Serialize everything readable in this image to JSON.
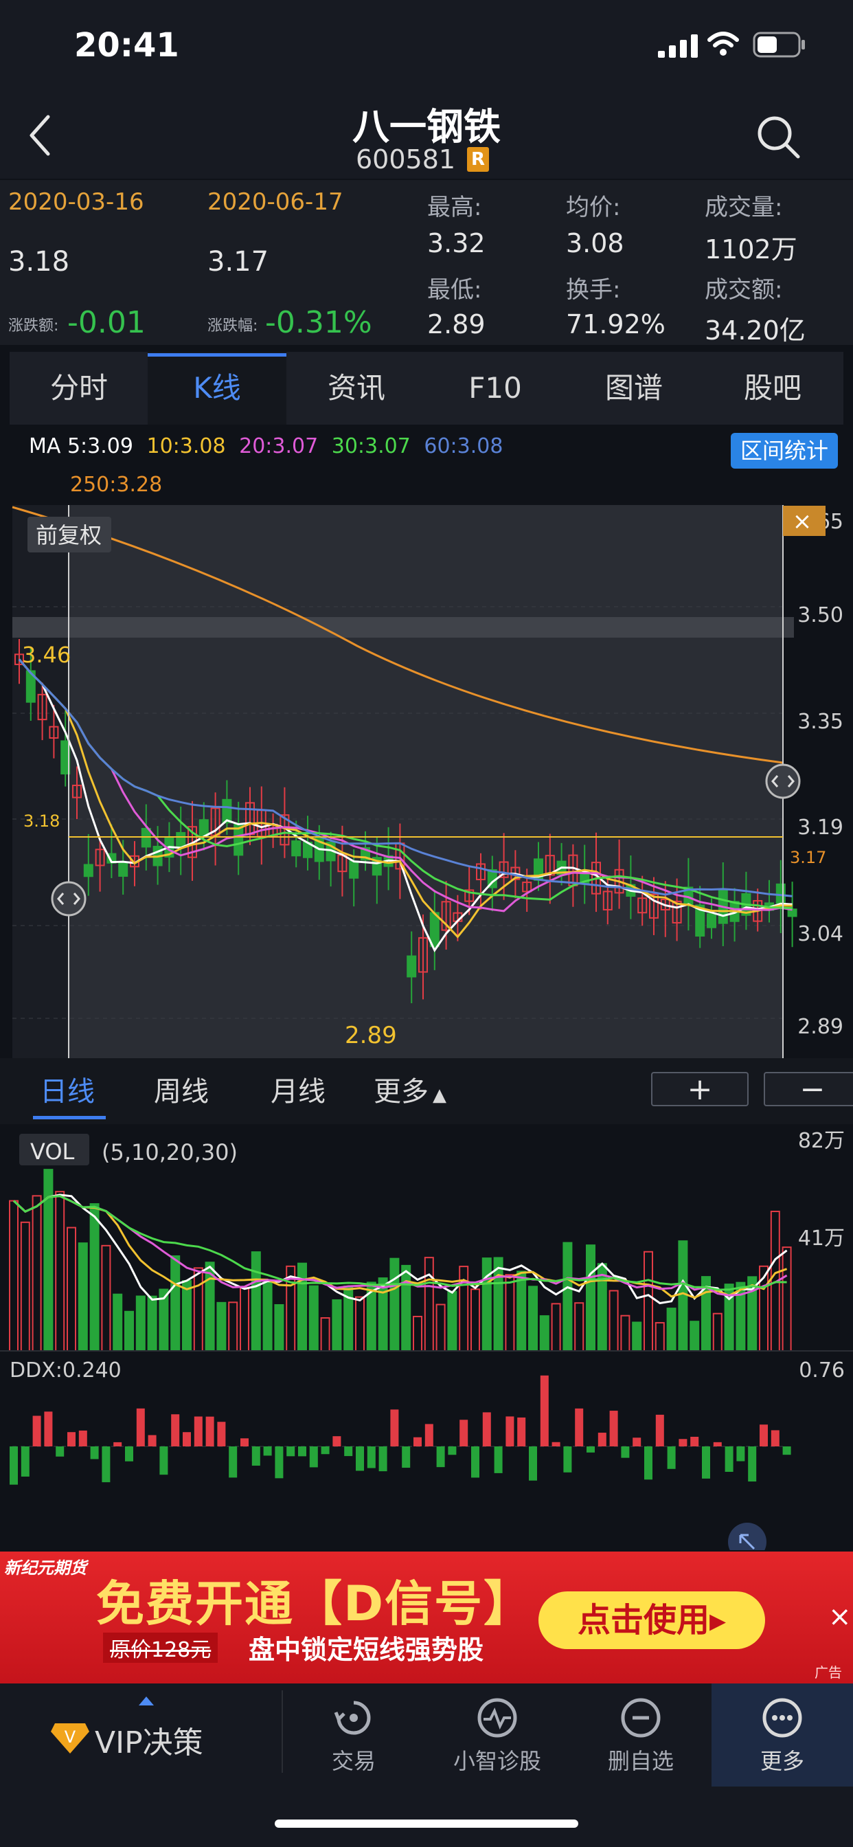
{
  "status_bar": {
    "time": "20:41"
  },
  "header": {
    "title": "八一钢铁",
    "code": "600581",
    "badge": "R"
  },
  "info": {
    "start_date": "2020-03-16",
    "end_date": "2020-06-17",
    "start_price": "3.18",
    "end_price": "3.17",
    "change_amount_label": "涨跌额:",
    "change_amount": "-0.01",
    "change_pct_label": "涨跌幅:",
    "change_pct": "-0.31%",
    "high_label": "最高:",
    "high": "3.32",
    "low_label": "最低:",
    "low": "2.89",
    "avg_label": "均价:",
    "avg": "3.08",
    "turnover_label": "换手:",
    "turnover": "71.92%",
    "volume_label": "成交量:",
    "volume": "1102万",
    "amount_label": "成交额:",
    "amount": "34.20亿"
  },
  "tabs": [
    "分时",
    "K线",
    "资讯",
    "F10",
    "图谱",
    "股吧"
  ],
  "active_tab": "K线",
  "ma": {
    "ma5": "MA 5:3.09",
    "ma10": "10:3.08",
    "ma20": "20:3.07",
    "ma30": "30:3.07",
    "ma60": "60:3.08",
    "ma250": "250:3.28"
  },
  "range_stat_button": "区间统计",
  "adjust_label": "前复权",
  "price_axis": [
    "3.65",
    "3.50",
    "3.35",
    "3.19",
    "3.04",
    "2.89"
  ],
  "annotations": {
    "high_mark": "3.46",
    "start_mark": "3.18",
    "low_mark": "2.89",
    "end_mark": "3.17",
    "close_x": "×"
  },
  "period_tabs": [
    "日线",
    "周线",
    "月线",
    "更多"
  ],
  "zoom": {
    "plus": "+",
    "minus": "−"
  },
  "volume_panel": {
    "label": "VOL",
    "params": "(5,10,20,30)",
    "axis_top": "82万",
    "axis_mid": "41万"
  },
  "ddx_panel": {
    "label": "DDX:0.240",
    "axis_top": "0.76"
  },
  "ad": {
    "brand": "新纪元期货",
    "headline": "免费开通【D信号】",
    "old_price": "原价128元",
    "subline": "盘中锁定短线强势股",
    "cta": "点击使用▸",
    "tag": "广告",
    "close": "×"
  },
  "bottom_nav": {
    "vip": "VIP决策",
    "items": [
      "交易",
      "小智诊股",
      "删自选",
      "更多"
    ]
  },
  "colors": {
    "up": "#e23c45",
    "down": "#26a53a",
    "accent": "#3e7df0",
    "ma5": "#ffffff",
    "ma10": "#f2c230",
    "ma20": "#e05bd8",
    "ma30": "#4cd94c",
    "ma60": "#5a82d6",
    "ma250": "#e8912a"
  }
}
